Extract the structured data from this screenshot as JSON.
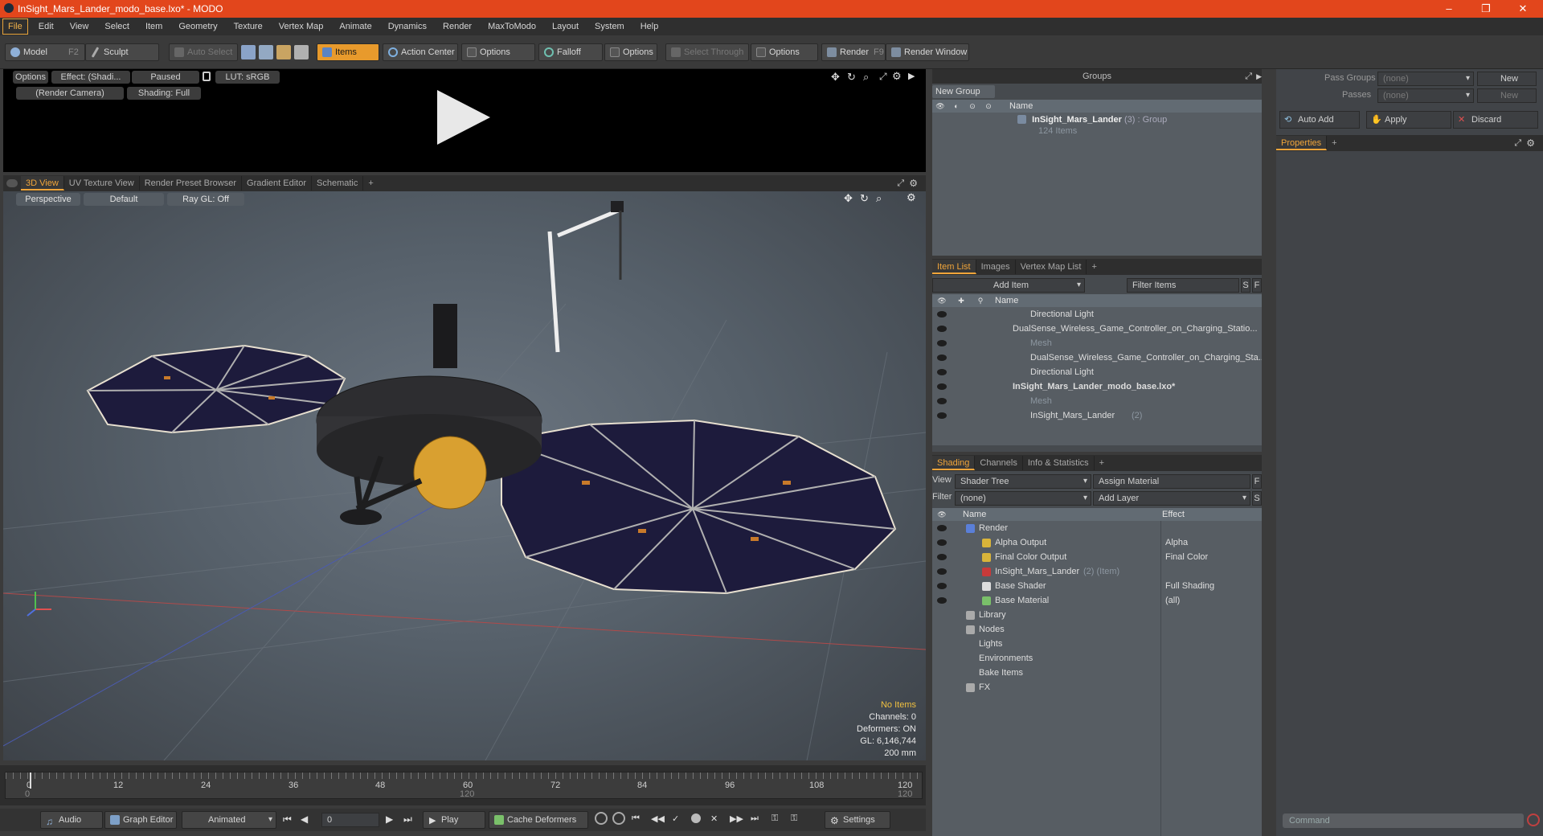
{
  "window": {
    "title": "InSight_Mars_Lander_modo_base.lxo* - MODO",
    "minimize": "–",
    "restore": "❐",
    "close": "✕"
  },
  "menu": [
    "File",
    "Edit",
    "View",
    "Select",
    "Item",
    "Geometry",
    "Texture",
    "Vertex Map",
    "Animate",
    "Dynamics",
    "Render",
    "MaxToModo",
    "Layout",
    "System",
    "Help"
  ],
  "toolbar": {
    "model": "Model",
    "model_key": "F2",
    "sculpt": "Sculpt",
    "auto_select": "Auto Select",
    "items": "Items",
    "action_center": "Action Center",
    "options1": "Options",
    "falloff": "Falloff",
    "options2": "Options",
    "select_through": "Select Through",
    "options3": "Options",
    "render": "Render",
    "render_key": "F9",
    "render_window": "Render Window"
  },
  "preview": {
    "options": "Options",
    "effect": "Effect: (Shadi...",
    "paused": "Paused",
    "lut": "LUT: sRGB",
    "camera": "(Render Camera)",
    "shading": "Shading: Full"
  },
  "viewtabs": [
    "3D View",
    "UV Texture View",
    "Render Preset Browser",
    "Gradient Editor",
    "Schematic",
    "+"
  ],
  "viewport": {
    "perspective": "Perspective",
    "default": "Default",
    "raygl": "Ray GL: Off",
    "stats": {
      "no_items": "No Items",
      "channels": "Channels: 0",
      "deformers": "Deformers: ON",
      "gl": "GL: 6,146,744",
      "size": "200 mm"
    }
  },
  "timeline": {
    "ticks": [
      "0",
      "12",
      "24",
      "36",
      "48",
      "60",
      "72",
      "84",
      "96",
      "108",
      "120"
    ],
    "sub_start": "0",
    "sub_mid": "120",
    "sub_end": "120"
  },
  "bottombar": {
    "audio": "Audio",
    "graph_editor": "Graph Editor",
    "animated": "Animated",
    "frame": "0",
    "play": "Play",
    "cache_deformers": "Cache Deformers",
    "settings": "Settings"
  },
  "groups": {
    "title": "Groups",
    "new_group": "New Group",
    "col_name": "Name",
    "item_name": "InSight_Mars_Lander",
    "item_count": "(3)",
    "item_type": ": Group",
    "item_sub": "124 Items"
  },
  "itemlist": {
    "tabs": [
      "Item List",
      "Images",
      "Vertex Map List",
      "+"
    ],
    "add_item": "Add Item",
    "filter_items": "Filter Items",
    "s": "S",
    "f": "F",
    "col_name": "Name",
    "rows": [
      {
        "label": "Directional Light",
        "indent": 2,
        "dim": false,
        "bold": false
      },
      {
        "label": "DualSense_Wireless_Game_Controller_on_Charging_Statio...",
        "indent": 1,
        "dim": false,
        "bold": false
      },
      {
        "label": "Mesh",
        "indent": 2,
        "dim": true,
        "bold": false
      },
      {
        "label": "DualSense_Wireless_Game_Controller_on_Charging_Sta...",
        "indent": 2,
        "dim": false,
        "bold": false
      },
      {
        "label": "Directional Light",
        "indent": 2,
        "dim": false,
        "bold": false
      },
      {
        "label": "InSight_Mars_Lander_modo_base.lxo*",
        "indent": 1,
        "dim": false,
        "bold": true
      },
      {
        "label": "Mesh",
        "indent": 2,
        "dim": true,
        "bold": false
      },
      {
        "label": "InSight_Mars_Lander",
        "suffix": "(2)",
        "indent": 2,
        "dim": false,
        "bold": false
      }
    ]
  },
  "shading": {
    "tabs": [
      "Shading",
      "Channels",
      "Info & Statistics",
      "+"
    ],
    "view_label": "View",
    "view_value": "Shader Tree",
    "assign_material": "Assign Material",
    "f": "F",
    "filter_label": "Filter",
    "filter_value": "(none)",
    "add_layer": "Add Layer",
    "s": "S",
    "col_name": "Name",
    "col_effect": "Effect",
    "rows": [
      {
        "label": "Render",
        "effect": "",
        "indent": 1,
        "icon": "#5a7fd8"
      },
      {
        "label": "Alpha Output",
        "effect": "Alpha",
        "indent": 2,
        "icon": "#d9b43a"
      },
      {
        "label": "Final Color Output",
        "effect": "Final Color",
        "indent": 2,
        "icon": "#d9b43a"
      },
      {
        "label": "InSight_Mars_Lander",
        "suffix": "(2) (Item)",
        "effect": "",
        "indent": 2,
        "icon": "#c83a3a"
      },
      {
        "label": "Base Shader",
        "effect": "Full Shading",
        "indent": 2,
        "icon": "#dddddd"
      },
      {
        "label": "Base Material",
        "effect": "(all)",
        "indent": 2,
        "icon": "#7ac06a"
      },
      {
        "label": "Library",
        "effect": "",
        "indent": 1,
        "icon": "#aaaaaa"
      },
      {
        "label": "Nodes",
        "effect": "",
        "indent": 1,
        "icon": "#aaaaaa"
      },
      {
        "label": "Lights",
        "effect": "",
        "indent": 1,
        "icon": ""
      },
      {
        "label": "Environments",
        "effect": "",
        "indent": 1,
        "icon": ""
      },
      {
        "label": "Bake Items",
        "effect": "",
        "indent": 1,
        "icon": ""
      },
      {
        "label": "FX",
        "effect": "",
        "indent": 1,
        "icon": "#aaaaaa"
      }
    ]
  },
  "passes": {
    "pass_groups": "Pass Groups",
    "passes": "Passes",
    "none1": "(none)",
    "none2": "(none)",
    "new1": "New",
    "new2": "New"
  },
  "props": {
    "auto_add": "Auto Add",
    "apply": "Apply",
    "discard": "Discard",
    "tab": "Properties",
    "plus": "+"
  },
  "command": {
    "placeholder": "Command"
  }
}
